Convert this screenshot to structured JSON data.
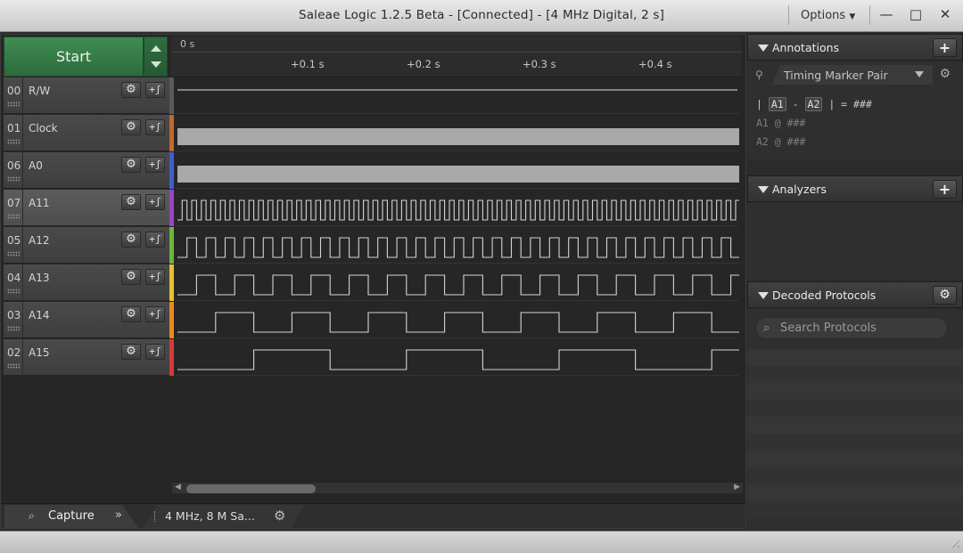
{
  "window": {
    "title": "Saleae Logic 1.2.5 Beta - [Connected] - [4 MHz Digital, 2 s]",
    "options_label": "Options",
    "minimize": "—",
    "maximize": "□",
    "close": "✕"
  },
  "capture": {
    "start_label": "Start"
  },
  "timeline": {
    "origin": "0 s",
    "ticks": [
      "+0.1 s",
      "+0.2 s",
      "+0.3 s",
      "+0.4 s"
    ]
  },
  "channels": [
    {
      "num": "00",
      "name": "R/W",
      "color": "#5a5a5a",
      "signal": "low",
      "period": 0
    },
    {
      "num": "01",
      "name": "Clock",
      "color": "#c0692a",
      "signal": "dense",
      "period": 0
    },
    {
      "num": "06",
      "name": "A0",
      "color": "#3f5fd0",
      "signal": "dense",
      "period": 0
    },
    {
      "num": "07",
      "name": "A11",
      "color": "#9a43c8",
      "signal": "square",
      "period": 10.7
    },
    {
      "num": "05",
      "name": "A12",
      "color": "#6ab63d",
      "signal": "square",
      "period": 21.4
    },
    {
      "num": "04",
      "name": "A13",
      "color": "#e6c12d",
      "signal": "square",
      "period": 42.8
    },
    {
      "num": "03",
      "name": "A14",
      "color": "#e8891f",
      "signal": "square",
      "period": 85.6
    },
    {
      "num": "02",
      "name": "A15",
      "color": "#d63a3a",
      "signal": "square",
      "period": 171.2
    }
  ],
  "channel_buttons": {
    "settings_icon": "⚙",
    "trigger_icon": "+ʃ"
  },
  "bottom": {
    "capture_tab": "Capture",
    "more": "»",
    "device_label": "4 MHz, 8 M Sa..."
  },
  "annotations": {
    "title": "Annotations",
    "add": "+",
    "marker_pair": "Timing Marker Pair",
    "line1": {
      "a1": "A1",
      "dash": "-",
      "a2": "A2",
      "eq": "| = ###"
    },
    "line2": "A1 @ ###",
    "line3": "A2 @ ###"
  },
  "analyzers": {
    "title": "Analyzers",
    "add": "+"
  },
  "decoded": {
    "title": "Decoded Protocols",
    "search_placeholder": "Search Protocols"
  }
}
